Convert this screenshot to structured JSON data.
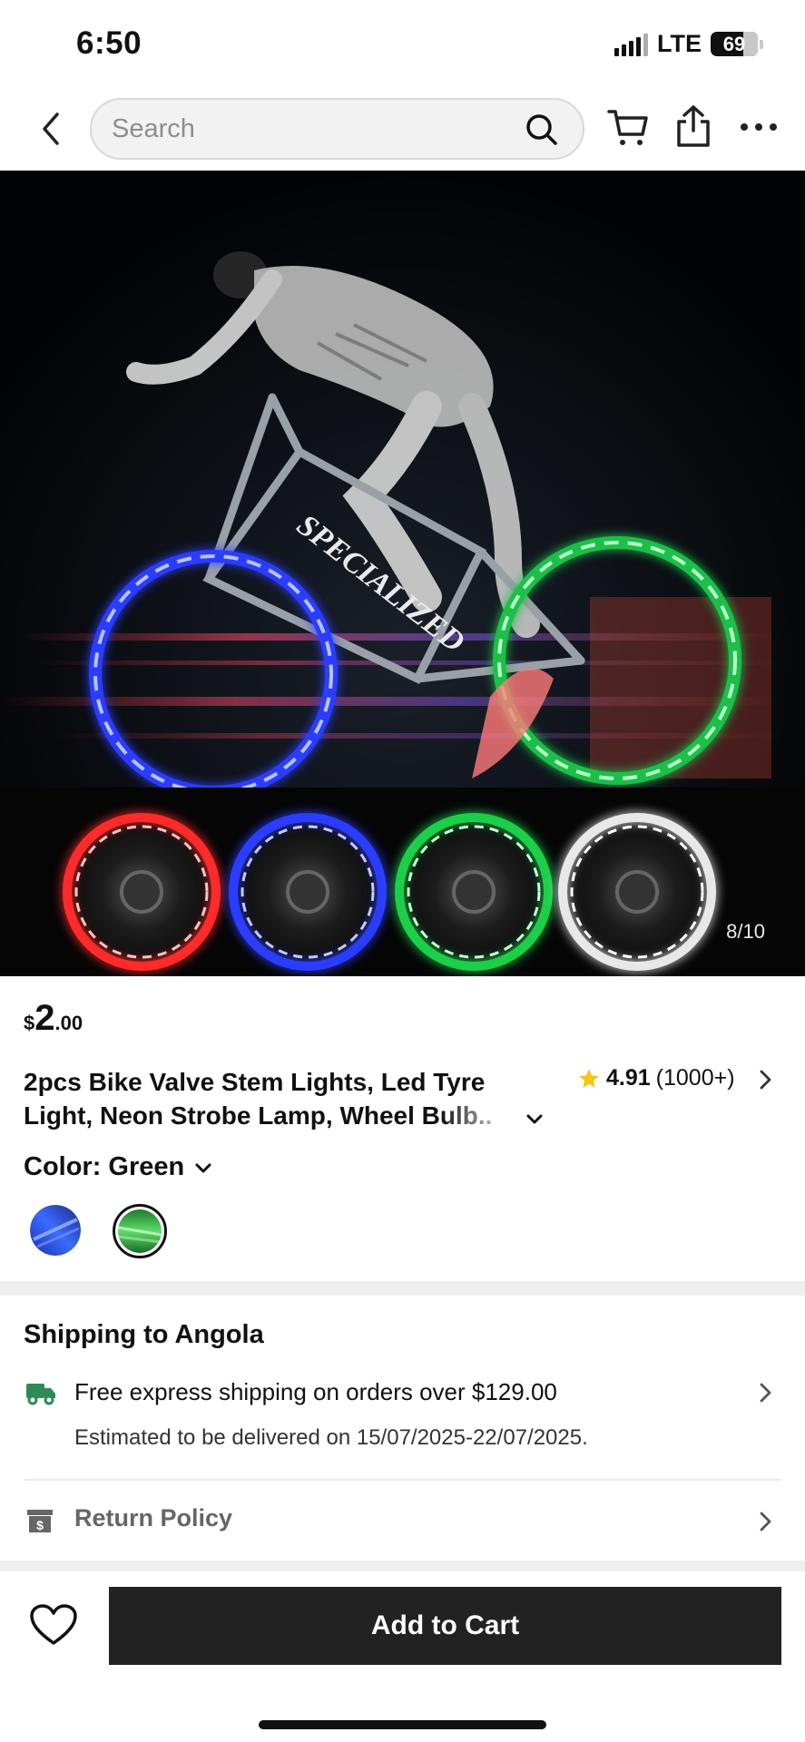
{
  "status_bar": {
    "time": "6:50",
    "network": "LTE",
    "battery": "69"
  },
  "nav": {
    "search_placeholder": "Search",
    "icons": [
      "back-arrow-icon",
      "search-icon",
      "cart-icon",
      "share-icon",
      "more-icon"
    ]
  },
  "gallery": {
    "counter": "8/10"
  },
  "product": {
    "price": {
      "currency": "$",
      "integer": "2",
      "decimal": ".00"
    },
    "title_line1": "2pcs Bike Valve Stem Lights, Led Tyre",
    "title_line2": "Light, Neon Strobe Lamp, Wheel Bulb..",
    "rating": {
      "score": "4.91",
      "count": "(1000+)"
    },
    "color_label": "Color: Green",
    "swatches": [
      {
        "name": "Blue",
        "selected": false,
        "color": "#2f57d8"
      },
      {
        "name": "Green",
        "selected": true,
        "color": "#37b84a"
      }
    ]
  },
  "shipping": {
    "title": "Shipping to Angola",
    "offer": "Free express shipping on orders over $129.00",
    "estimate": "Estimated to be delivered on 15/07/2025-22/07/2025.",
    "return_policy": "Return Policy",
    "accent_color": "#2e8b57"
  },
  "actions": {
    "add_to_cart": "Add to Cart"
  }
}
